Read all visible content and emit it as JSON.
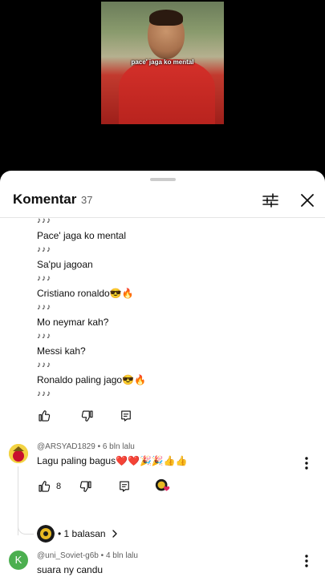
{
  "video": {
    "caption": "pace' jaga ko mental"
  },
  "header": {
    "title": "Komentar",
    "count": "37"
  },
  "thread": {
    "lines": [
      "♪♪♪",
      "Pace' jaga ko mental",
      "♪♪♪",
      "Sa'pu jagoan",
      "♪♪♪",
      "Cristiano ronaldo😎🔥",
      "♪♪♪",
      "Mo neymar kah?",
      "♪♪♪",
      "Messi kah?",
      "♪♪♪",
      "Ronaldo paling jago😎🔥",
      "♪♪♪"
    ]
  },
  "comments": [
    {
      "author": "@ARSYAD1829",
      "time": "6 bln lalu",
      "text": "Lagu paling bagus❤️❤️🎉🎉👍👍",
      "likes": "8",
      "replies_label": "• 1 balasan",
      "avatar_color": "#e8c21e"
    },
    {
      "author": "@uni_Soviet-g6b",
      "time": "4 bln lalu",
      "text": "suara ny candu",
      "avatar_letter": "K",
      "avatar_color": "#4caf50"
    }
  ],
  "icons": {
    "filter": "sliders-icon",
    "close": "close-icon",
    "like": "thumbs-up-icon",
    "dislike": "thumbs-down-icon",
    "reply": "comment-reply-icon",
    "more": "more-vert-icon",
    "chevron": "chevron-right-icon",
    "creator_heart": "creator-heart-icon"
  }
}
